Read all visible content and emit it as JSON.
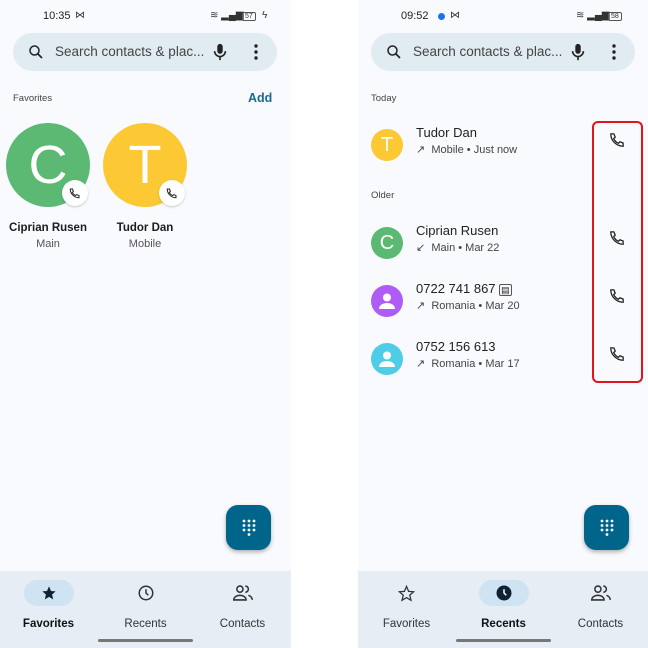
{
  "left": {
    "status": {
      "time": "10:35",
      "battery": "57"
    },
    "search": {
      "placeholder": "Search contacts & plac..."
    },
    "favorites": {
      "title": "Favorites",
      "add_label": "Add",
      "items": [
        {
          "initial": "C",
          "name": "Ciprian Rusen",
          "sub": "Main",
          "color": "#5bb974"
        },
        {
          "initial": "T",
          "name": "Tudor Dan",
          "sub": "Mobile",
          "color": "#fcc934"
        }
      ]
    },
    "nav": [
      {
        "label": "Favorites",
        "icon": "star-filled-icon",
        "active": true
      },
      {
        "label": "Recents",
        "icon": "clock-icon",
        "active": false
      },
      {
        "label": "Contacts",
        "icon": "people-icon",
        "active": false
      }
    ]
  },
  "right": {
    "status": {
      "time": "09:52",
      "battery": "58"
    },
    "search": {
      "placeholder": "Search contacts & plac..."
    },
    "today_label": "Today",
    "older_label": "Older",
    "recents": [
      {
        "initial": "T",
        "name": "Tudor Dan",
        "direction": "outgoing",
        "sub": "Mobile • Just now",
        "color": "#fcc934"
      },
      {
        "initial": "C",
        "name": "Ciprian Rusen",
        "direction": "incoming",
        "sub": "Main • Mar 22",
        "color": "#5bb974"
      },
      {
        "initial": "",
        "name": "0722 741 867",
        "direction": "outgoing",
        "sub": "Romania • Mar 20",
        "color": "#af5cf7",
        "has_sim_icon": true
      },
      {
        "initial": "",
        "name": "0752 156 613",
        "direction": "outgoing",
        "sub": "Romania • Mar 17",
        "color": "#4ecde6"
      }
    ],
    "nav": [
      {
        "label": "Favorites",
        "icon": "star-outline-icon",
        "active": false
      },
      {
        "label": "Recents",
        "icon": "clock-filled-icon",
        "active": true
      },
      {
        "label": "Contacts",
        "icon": "people-icon",
        "active": false
      }
    ]
  },
  "colors": {
    "accent": "#00658a",
    "highlight": "#e0141e",
    "nav_active": "#cfe3f3"
  }
}
